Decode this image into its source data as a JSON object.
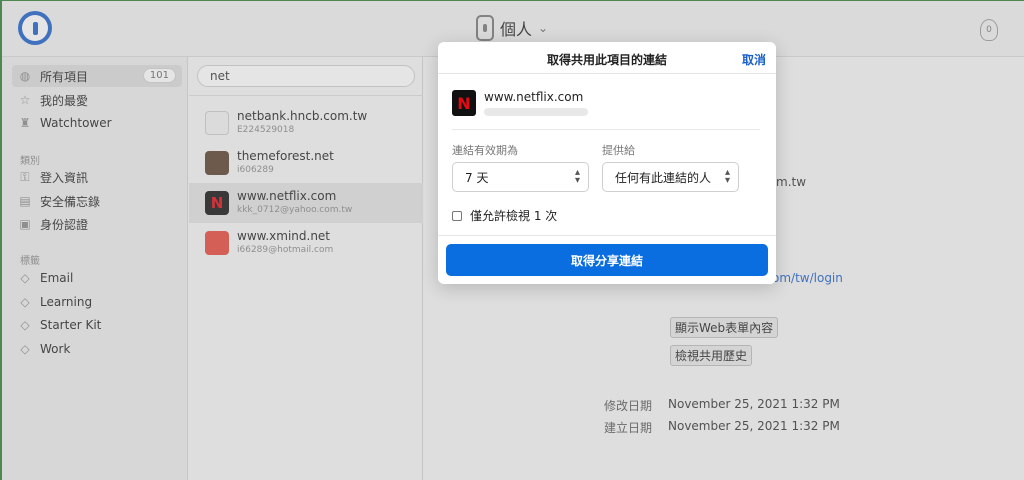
{
  "topbar": {
    "vault_name": "個人",
    "chevron": "⌄",
    "notification_count": "0"
  },
  "sidebar": {
    "items": [
      {
        "label": "所有項目",
        "count": "101",
        "icon": "globe-icon"
      },
      {
        "label": "我的最愛",
        "icon": "star-icon"
      },
      {
        "label": "Watchtower",
        "icon": "tower-icon"
      }
    ],
    "section_categories": "類別",
    "categories": [
      {
        "label": "登入資訊",
        "icon": "key-icon"
      },
      {
        "label": "安全備忘錄",
        "icon": "note-icon"
      },
      {
        "label": "身份認證",
        "icon": "id-card-icon"
      }
    ],
    "section_tags": "標籤",
    "tags": [
      {
        "label": "Email",
        "icon": "tag-icon"
      },
      {
        "label": "Learning",
        "icon": "tag-icon"
      },
      {
        "label": "Starter Kit",
        "icon": "tag-icon"
      },
      {
        "label": "Work",
        "icon": "tag-icon"
      }
    ]
  },
  "list": {
    "search_value": "net",
    "items": [
      {
        "title": "netbank.hncb.com.tw",
        "subtitle": "E224529018"
      },
      {
        "title": "themeforest.net",
        "subtitle": "i606289"
      },
      {
        "title": "www.netflix.com",
        "subtitle": "kkk_0712@yahoo.com.tw"
      },
      {
        "title": "www.xmind.net",
        "subtitle": "i66289@hotmail.com"
      }
    ]
  },
  "detail": {
    "partial_text": "m.tw",
    "partial_link": "om/tw/login",
    "show_web_form": "顯示Web表單內容",
    "view_share_history": "檢視共用歷史",
    "modified_label": "修改日期",
    "modified_value": "November 25, 2021 1:32 PM",
    "created_label": "建立日期",
    "created_value": "November 25, 2021 1:32 PM"
  },
  "modal": {
    "title": "取得共用此項目的連結",
    "cancel": "取消",
    "item_title": "www.netflix.com",
    "nf_letter": "N",
    "expiry_label": "連結有效期為",
    "expiry_value": "7 天",
    "share_with_label": "提供給",
    "share_with_value": "任何有此連結的人",
    "view_once_label": "僅允許檢視 1 次",
    "primary_button": "取得分享連結"
  }
}
